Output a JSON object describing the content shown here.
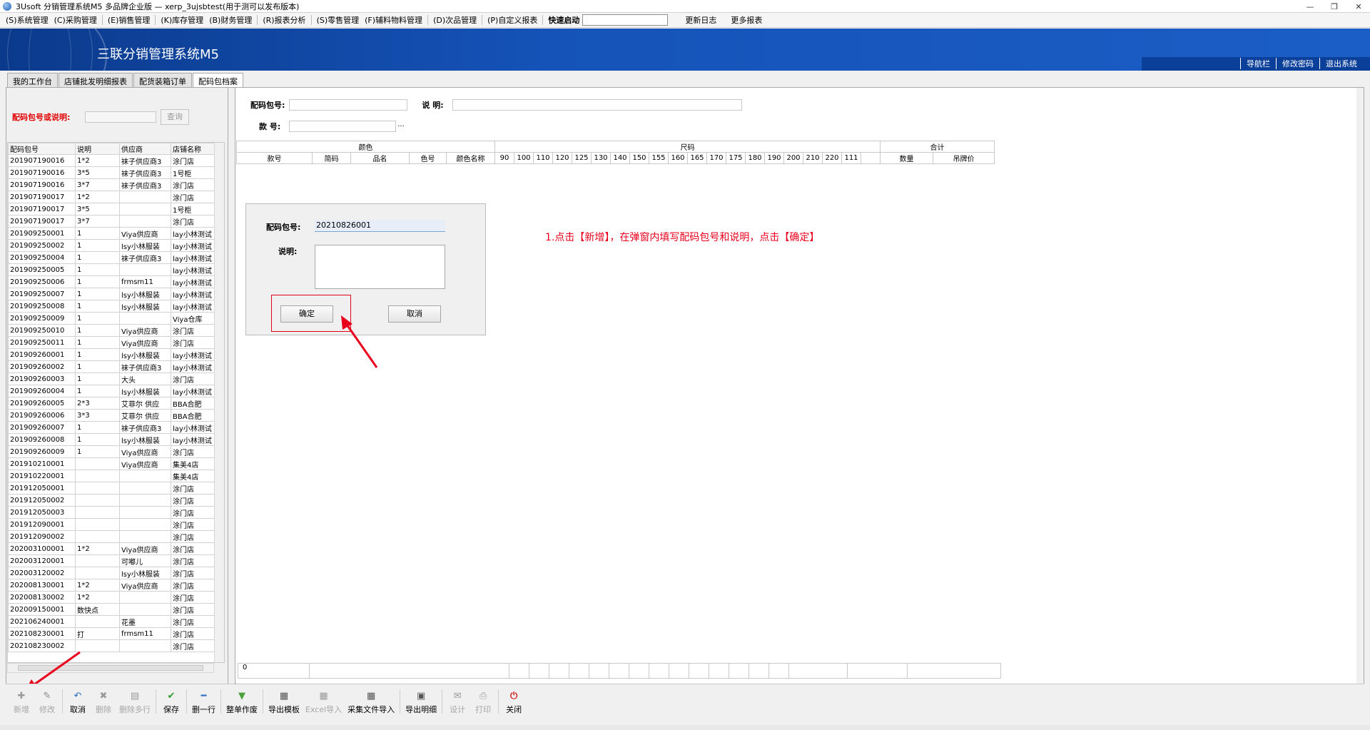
{
  "window": {
    "title": "3Usoft 分销管理系统M5 多品牌企业版 — xerp_3ujsbtest(用于测可以发布版本)",
    "controls": [
      "—",
      "❐",
      "✕"
    ]
  },
  "menu": {
    "items": [
      "(S)系统管理",
      "(C)采购管理",
      "(E)销售管理",
      "(K)库存管理",
      "(B)财务管理",
      "(R)报表分析",
      "(S)零售管理",
      "(F)辅料物料管理",
      "(D)次品管理",
      "(P)自定义报表"
    ],
    "quick_start_label": "快速启动",
    "extra": [
      "更新日志",
      "更多报表"
    ]
  },
  "banner": {
    "app_name": "三联分销管理系统M5",
    "links": [
      "导航栏",
      "修改密码",
      "退出系统"
    ]
  },
  "tabs": [
    "我的工作台",
    "店铺批发明细报表",
    "配货装箱订单",
    "配码包档案"
  ],
  "active_tab": 3,
  "left": {
    "search_label": "配码包号或说明:",
    "query_button": "查询",
    "columns": [
      "配码包号",
      "说明",
      "供应商",
      "店铺名称"
    ],
    "rows": [
      [
        "201907190016",
        "1*2",
        "袜子供应商3",
        "涂门店"
      ],
      [
        "201907190016",
        "3*5",
        "袜子供应商3",
        "1号柜"
      ],
      [
        "201907190016",
        "3*7",
        "袜子供应商3",
        "涂门店"
      ],
      [
        "201907190017",
        "1*2",
        "",
        "涂门店"
      ],
      [
        "201907190017",
        "3*5",
        "",
        "1号柜"
      ],
      [
        "201907190017",
        "3*7",
        "",
        "涂门店"
      ],
      [
        "201909250001",
        "1",
        "Viya供应商",
        "lay小林测试"
      ],
      [
        "201909250002",
        "1",
        "lsy小林服装",
        "lay小林测试"
      ],
      [
        "201909250004",
        "1",
        "袜子供应商3",
        "lay小林测试"
      ],
      [
        "201909250005",
        "1",
        "",
        "lay小林测试"
      ],
      [
        "201909250006",
        "1",
        "frmsm11",
        "lay小林测试"
      ],
      [
        "201909250007",
        "1",
        "lsy小林服装",
        "lay小林测试"
      ],
      [
        "201909250008",
        "1",
        "lsy小林服装",
        "lay小林测试"
      ],
      [
        "201909250009",
        "1",
        "",
        "Viya仓库"
      ],
      [
        "201909250010",
        "1",
        "Viya供应商",
        "涂门店"
      ],
      [
        "201909250011",
        "1",
        "Viya供应商",
        "涂门店"
      ],
      [
        "201909260001",
        "1",
        "lsy小林服装",
        "lay小林测试"
      ],
      [
        "201909260002",
        "1",
        "袜子供应商3",
        "lay小林测试"
      ],
      [
        "201909260003",
        "1",
        "大头",
        "涂门店"
      ],
      [
        "201909260004",
        "1",
        "lsy小林服装",
        "lay小林测试"
      ],
      [
        "201909260005",
        "2*3",
        "艾菲尔 供应",
        "BBA合肥"
      ],
      [
        "201909260006",
        "3*3",
        "艾菲尔 供应",
        "BBA合肥"
      ],
      [
        "201909260007",
        "1",
        "袜子供应商3",
        "lay小林测试"
      ],
      [
        "201909260008",
        "1",
        "lsy小林服装",
        "lay小林测试"
      ],
      [
        "201909260009",
        "1",
        "Viya供应商",
        "涂门店"
      ],
      [
        "201910210001",
        "",
        "Viya供应商",
        "集美4店"
      ],
      [
        "201910220001",
        "",
        "",
        "集美4店"
      ],
      [
        "201912050001",
        "",
        "",
        "涂门店"
      ],
      [
        "201912050002",
        "",
        "",
        "涂门店"
      ],
      [
        "201912050003",
        "",
        "",
        "涂门店"
      ],
      [
        "201912090001",
        "",
        "",
        "涂门店"
      ],
      [
        "201912090002",
        "",
        "",
        "涂门店"
      ],
      [
        "202003100001",
        "1*2",
        "Viya供应商",
        "涂门店"
      ],
      [
        "202003120001",
        "",
        "可嘟儿",
        "涂门店"
      ],
      [
        "202003120002",
        "",
        "lsy小林服装",
        "涂门店"
      ],
      [
        "202008130001",
        "1*2",
        "Viya供应商",
        "涂门店"
      ],
      [
        "202008130002",
        "1*2",
        "",
        "涂门店"
      ],
      [
        "202009150001",
        "数快点",
        "",
        "涂门店"
      ],
      [
        "202106240001",
        "",
        "花墨",
        "涂门店"
      ],
      [
        "202108230001",
        "打",
        "frmsm11",
        "涂门店"
      ],
      [
        "202108230002",
        "",
        "",
        "涂门店"
      ]
    ]
  },
  "right": {
    "code_label": "配码包号:",
    "desc_label": "说 明:",
    "style_label": "款 号:",
    "ellipsis": "···",
    "group_headers": [
      "颜色",
      "尺码",
      "合计"
    ],
    "sub_headers": [
      "款号",
      "简码",
      "品名",
      "色号",
      "颜色名称"
    ],
    "sizes": [
      "90",
      "100",
      "110",
      "120",
      "125",
      "130",
      "140",
      "150",
      "155",
      "160",
      "165",
      "170",
      "175",
      "180",
      "190",
      "200",
      "210",
      "220",
      "111",
      ""
    ],
    "total_headers": [
      "数量",
      "吊牌价"
    ],
    "footer_value": "0"
  },
  "dialog": {
    "code_label": "配码包号:",
    "code_value": "20210826001",
    "desc_label": "说明:",
    "ok_label": "确定",
    "cancel_label": "取消"
  },
  "annotation": "1.点击【新增】，在弹窗内填写配码包号和说明，点击【确定】",
  "toolbar": [
    {
      "label": "新增",
      "icon": "plus-icon",
      "enabled": false
    },
    {
      "label": "修改",
      "icon": "edit-icon",
      "enabled": false
    },
    {
      "label": "取消",
      "icon": "undo-icon",
      "enabled": true
    },
    {
      "label": "删除",
      "icon": "delete-icon",
      "enabled": false
    },
    {
      "label": "删除多行",
      "icon": "delete-rows-icon",
      "enabled": false
    },
    {
      "label": "保存",
      "icon": "check-icon",
      "enabled": true
    },
    {
      "label": "删一行",
      "icon": "minus-icon",
      "enabled": true
    },
    {
      "label": "整单作废",
      "icon": "basket-icon",
      "enabled": true
    },
    {
      "label": "导出模板",
      "icon": "export-template-icon",
      "enabled": true
    },
    {
      "label": "Excel导入",
      "icon": "excel-import-icon",
      "enabled": false
    },
    {
      "label": "采集文件导入",
      "icon": "file-import-icon",
      "enabled": true
    },
    {
      "label": "导出明细",
      "icon": "export-detail-icon",
      "enabled": true
    },
    {
      "label": "设计",
      "icon": "design-icon",
      "enabled": false
    },
    {
      "label": "打印",
      "icon": "print-icon",
      "enabled": false
    },
    {
      "label": "关闭",
      "icon": "close-icon",
      "enabled": true
    }
  ],
  "colors": {
    "banner": "#1553b8",
    "annotation": "#e8001c",
    "search_label": "#e00000"
  }
}
